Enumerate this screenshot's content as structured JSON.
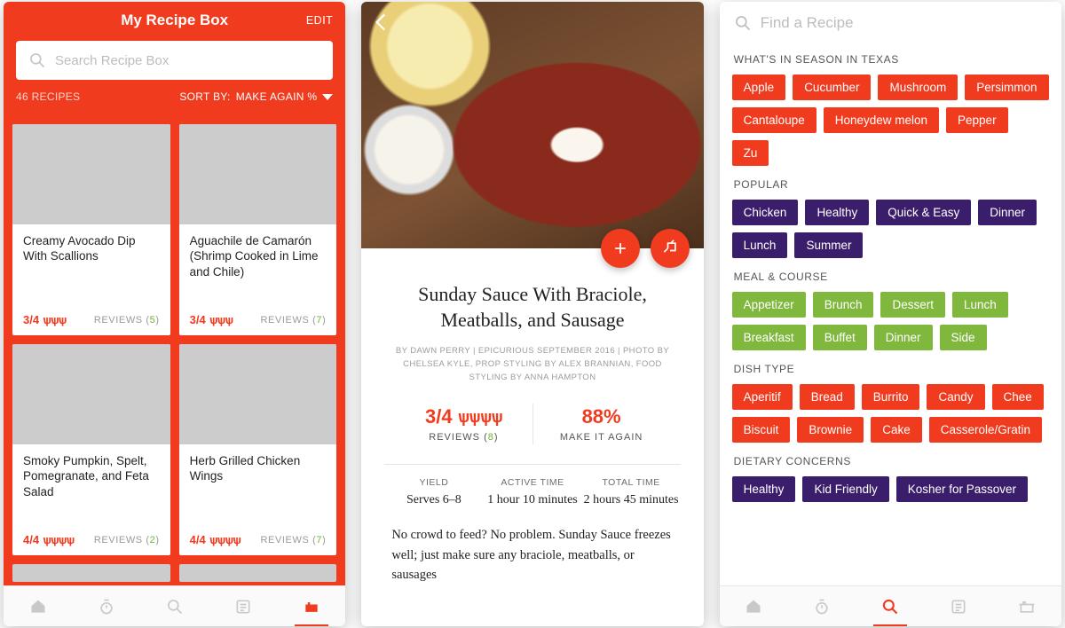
{
  "screen1": {
    "title": "My Recipe Box",
    "edit": "EDIT",
    "search_placeholder": "Search Recipe Box",
    "count": "46 RECIPES",
    "sort_label": "SORT BY:",
    "sort_value": "MAKE AGAIN %",
    "reviews_label": "REVIEWS",
    "cards": [
      {
        "title": "Creamy Avocado Dip With Scallions",
        "rating": "3/4",
        "reviews": "5"
      },
      {
        "title": "Aguachile de Camarón (Shrimp Cooked in Lime and Chile)",
        "rating": "3/4",
        "reviews": "7"
      },
      {
        "title": "Smoky Pumpkin, Spelt, Pomegranate, and Feta Salad",
        "rating": "4/4",
        "reviews": "2"
      },
      {
        "title": "Herb Grilled Chicken Wings",
        "rating": "4/4",
        "reviews": "7"
      }
    ]
  },
  "screen2": {
    "title": "Sunday Sauce With Braciole, Meatballs, and Sausage",
    "byline": "BY DAWN PERRY | EPICURIOUS SEPTEMBER 2016 | PHOTO BY CHELSEA KYLE, PROP STYLING BY ALEX BRANNIAN, FOOD STYLING BY ANNA HAMPTON",
    "rating": "3/4",
    "reviews_label": "REVIEWS",
    "reviews": "8",
    "make_again_pct": "88%",
    "make_again_label": "MAKE IT AGAIN",
    "yield_label": "YIELD",
    "yield": "Serves 6–8",
    "active_label": "ACTIVE TIME",
    "active": "1 hour 10 minutes",
    "total_label": "TOTAL TIME",
    "total": "2 hours 45 minutes",
    "paragraph": "No crowd to feed? No problem. Sunday Sauce freezes well; just make sure any braciole, meatballs, or sausages"
  },
  "screen3": {
    "search_placeholder": "Find a Recipe",
    "sections": [
      {
        "title": "WHAT'S IN SEASON IN TEXAS",
        "color": "c-orange",
        "chips": [
          "Apple",
          "Cucumber",
          "Mushroom",
          "Persimmon",
          "Cantaloupe",
          "Honeydew melon",
          "Pepper",
          "Zu"
        ]
      },
      {
        "title": "POPULAR",
        "color": "c-purple",
        "chips": [
          "Chicken",
          "Healthy",
          "Quick & Easy",
          "Dinner",
          "Lunch",
          "Summer"
        ]
      },
      {
        "title": "MEAL & COURSE",
        "color": "c-green",
        "chips": [
          "Appetizer",
          "Brunch",
          "Dessert",
          "Lunch",
          "Breakfast",
          "Buffet",
          "Dinner",
          "Side"
        ]
      },
      {
        "title": "DISH TYPE",
        "color": "c-orange",
        "chips": [
          "Aperitif",
          "Bread",
          "Burrito",
          "Candy",
          "Chee",
          "Biscuit",
          "Brownie",
          "Cake",
          "Casserole/Gratin"
        ]
      },
      {
        "title": "DIETARY CONCERNS",
        "color": "c-purple",
        "chips": [
          "Healthy",
          "Kid Friendly",
          "Kosher for Passover"
        ]
      }
    ]
  },
  "tabs": [
    "home",
    "timer",
    "search",
    "list",
    "pot"
  ]
}
